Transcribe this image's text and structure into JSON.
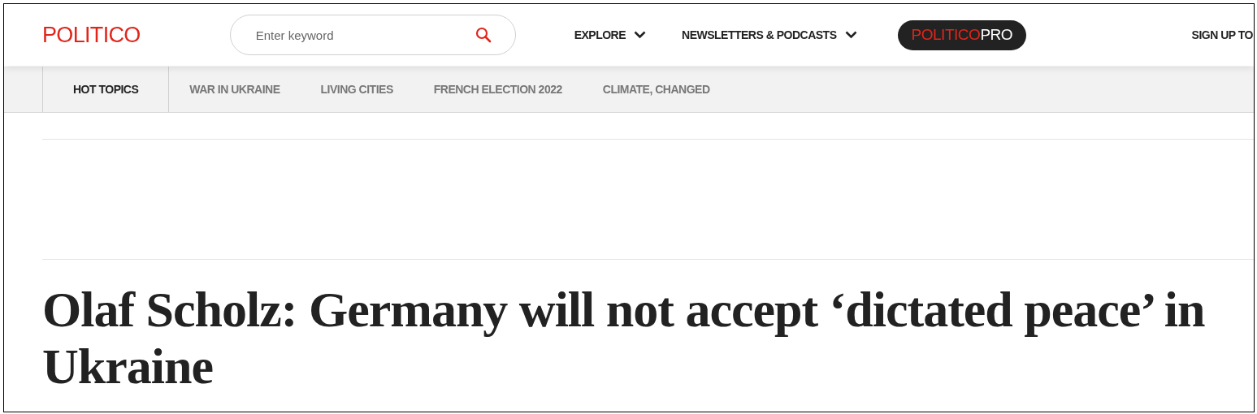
{
  "header": {
    "logo": "POLITICO",
    "search": {
      "placeholder": "Enter keyword"
    },
    "nav": [
      {
        "label": "EXPLORE",
        "dropdown": true
      },
      {
        "label": "NEWSLETTERS & PODCASTS",
        "dropdown": true
      }
    ],
    "pro_badge": {
      "brand": "POLITICO",
      "suffix": "PRO"
    },
    "signup": "SIGN UP TO"
  },
  "topics": [
    {
      "label": "HOT TOPICS",
      "selected": true
    },
    {
      "label": "WAR IN UKRAINE",
      "selected": false
    },
    {
      "label": "LIVING CITIES",
      "selected": false
    },
    {
      "label": "FRENCH ELECTION 2022",
      "selected": false
    },
    {
      "label": "CLIMATE, CHANGED",
      "selected": false
    }
  ],
  "article": {
    "headline": "Olaf Scholz: Germany will not accept ‘dictated peace’ in Ukraine"
  }
}
